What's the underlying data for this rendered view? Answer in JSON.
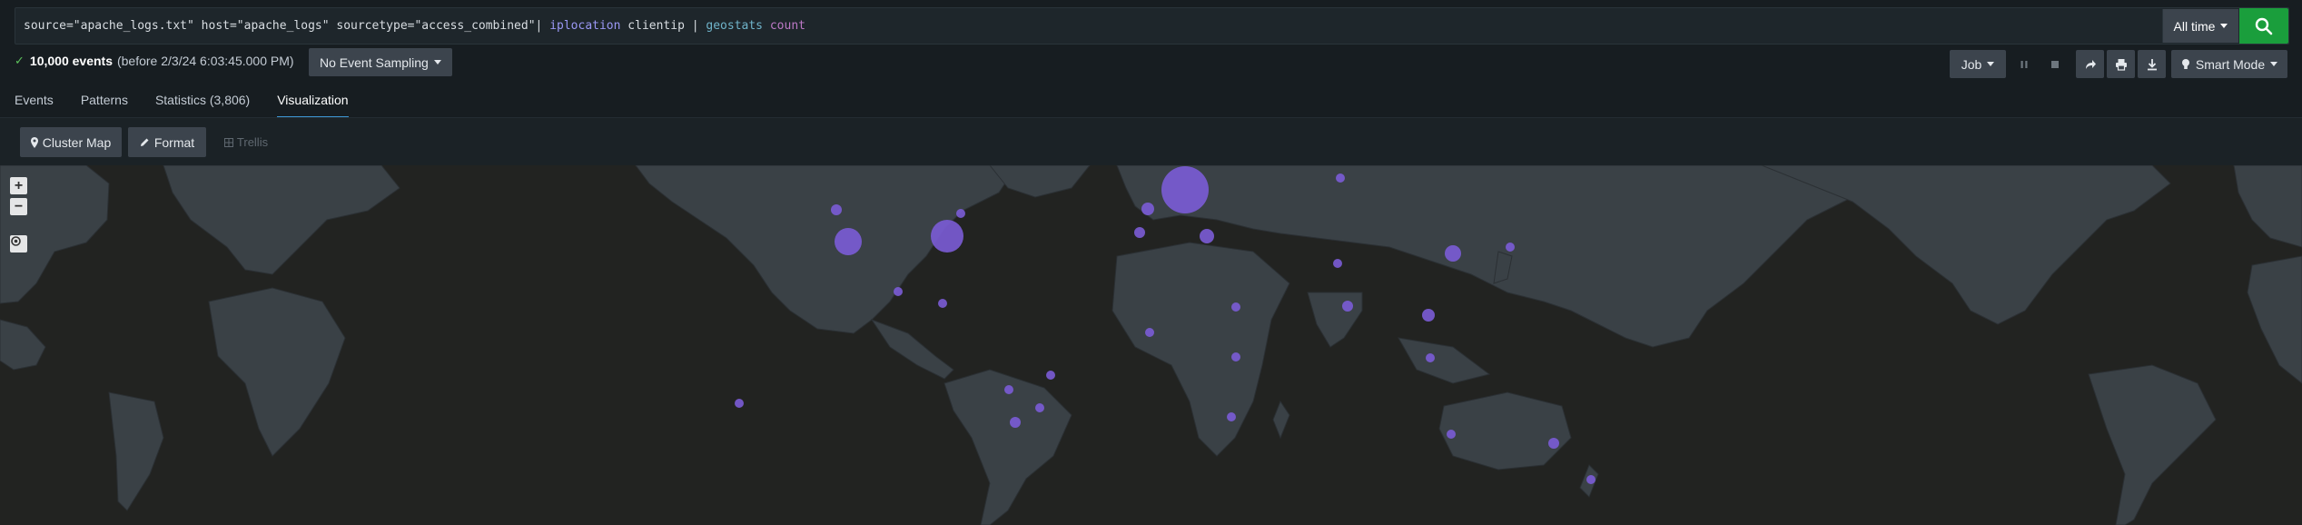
{
  "search": {
    "query_parts": {
      "p1": "source=\"apache_logs.txt\" host=\"apache_logs\" sourcetype=\"access_combined\"| ",
      "p2": "iplocation",
      "p3": " clientip | ",
      "p4": "geostats",
      "p5": " ",
      "p6": "count"
    },
    "time_range": "All time"
  },
  "status": {
    "event_count": "10,000 events",
    "before_text": "(before 2/3/24 6:03:45.000 PM)",
    "sampling": "No Event Sampling"
  },
  "job": {
    "job_label": "Job",
    "mode_label": "Smart Mode"
  },
  "tabs": [
    {
      "label": "Events"
    },
    {
      "label": "Patterns"
    },
    {
      "label": "Statistics (3,806)"
    },
    {
      "label": "Visualization"
    }
  ],
  "viz_toolbar": {
    "cluster_map": "Cluster Map",
    "format": "Format",
    "trellis": "Trellis"
  },
  "map_controls": {
    "zoom_in": "+",
    "zoom_out": "−"
  },
  "colors": {
    "accent": "#1a9e3c",
    "bubble": "#7b5cd6",
    "active_tab": "#3e97d5",
    "land": "#3a4146",
    "ocean": "#222321"
  },
  "icons": [
    "search-icon",
    "pause-icon",
    "stop-icon",
    "share-icon",
    "print-icon",
    "export-icon",
    "lightbulb-icon",
    "map-marker-icon",
    "pencil-icon",
    "trellis-icon",
    "locate-icon",
    "check-icon"
  ]
}
